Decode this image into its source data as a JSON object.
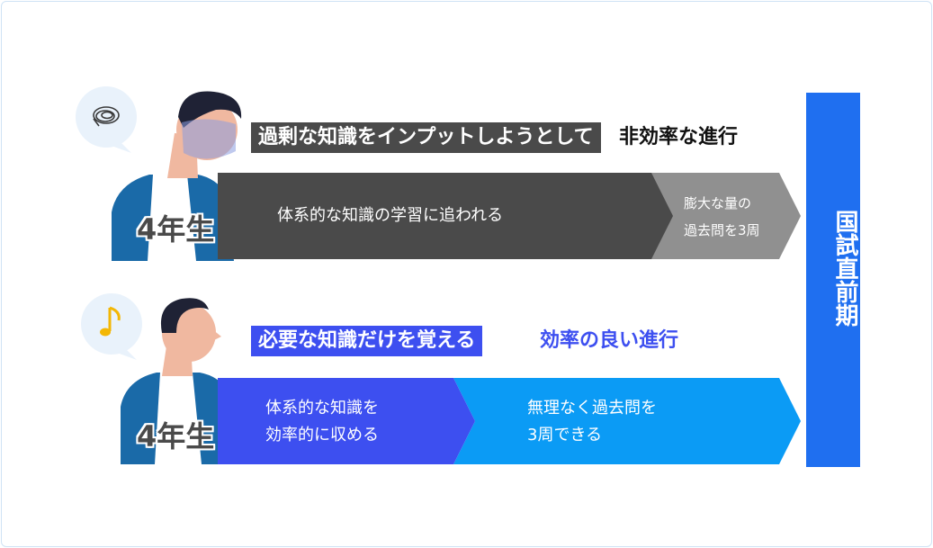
{
  "top_row": {
    "headline_box": "過剰な知識をインプットしようとして",
    "headline_plain": "非効率な進行",
    "grade": "4年生",
    "chevron_main": "体系的な知識の学習に追われる",
    "chevron_small_line1": "膨大な量の",
    "chevron_small_line2": "過去問を3周",
    "emotion_icon": "scribble-icon"
  },
  "bottom_row": {
    "headline_box": "必要な知識だけを覚える",
    "headline_plain": "効率の良い進行",
    "grade": "4年生",
    "chevron_left_line1": "体系的な知識を",
    "chevron_left_line2": "効率的に収める",
    "chevron_right_line1": "無理なく過去問を",
    "chevron_right_line2": "3周できる",
    "emotion_icon": "music-note-icon"
  },
  "vertical_label": "国試直前期",
  "colors": {
    "dark_gray": "#4a4a4a",
    "light_gray": "#909090",
    "indigo": "#3d4ff0",
    "sky_blue": "#0b9bf5",
    "royal_blue": "#1f6ff0",
    "jacket_blue": "#1a6aa8"
  }
}
